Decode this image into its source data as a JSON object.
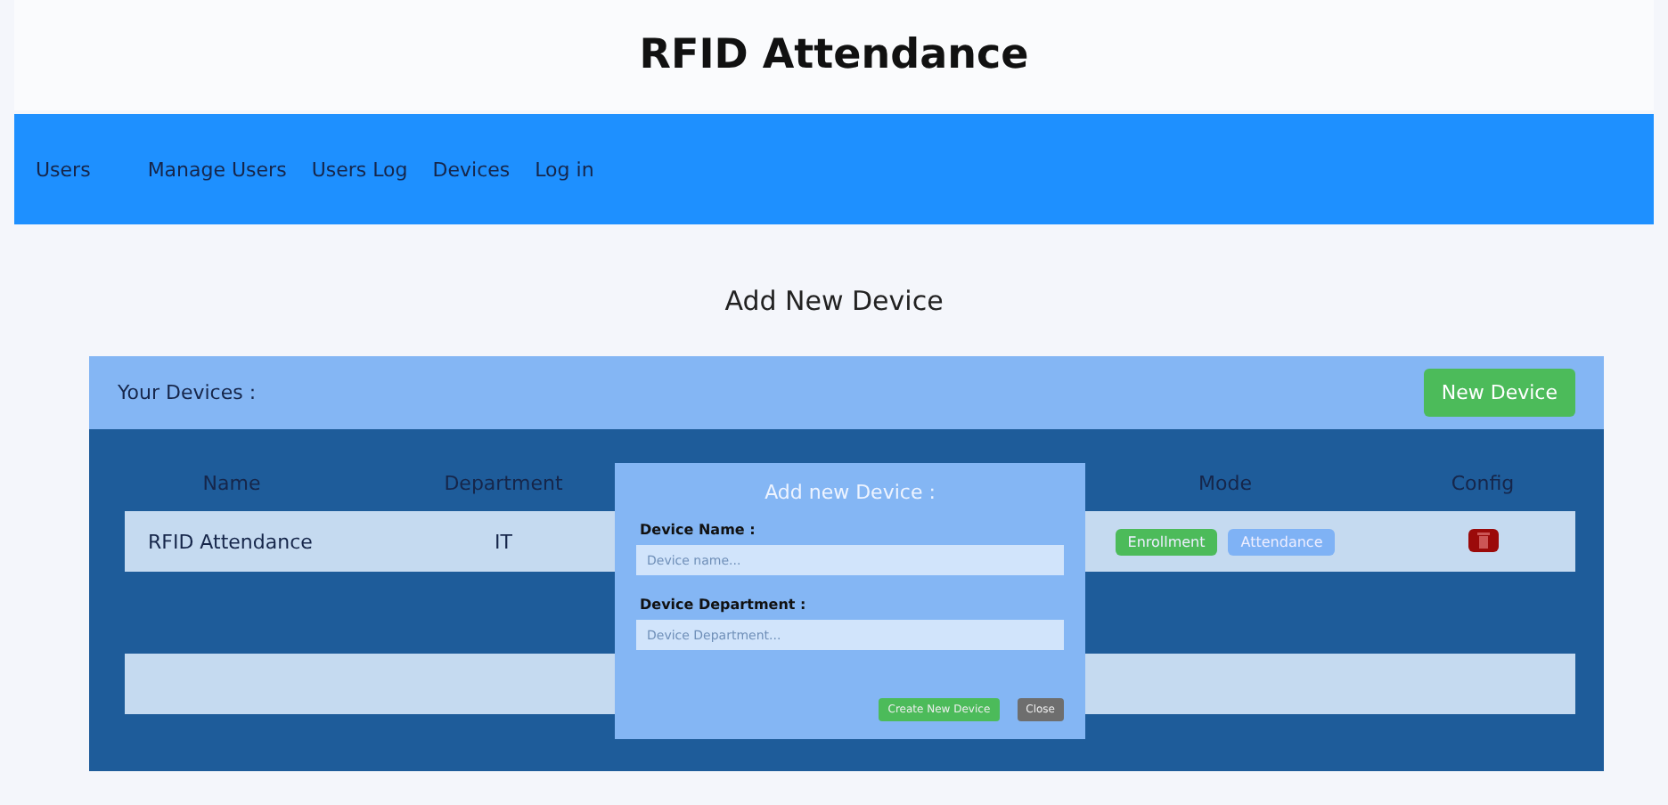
{
  "header": {
    "title": "RFID Attendance"
  },
  "nav": [
    {
      "label": "Users"
    },
    {
      "label": "Manage Users"
    },
    {
      "label": "Users Log"
    },
    {
      "label": "Devices"
    },
    {
      "label": "Log in"
    }
  ],
  "page_title": "Add New Device",
  "panel": {
    "title": "Your Devices :",
    "new_button": "New Device"
  },
  "table": {
    "columns": [
      "Name",
      "Department",
      "Mode",
      "Config"
    ],
    "rows": [
      {
        "name": "RFID Attendance",
        "department": "IT",
        "modes": [
          {
            "label": "Enrollment",
            "selected": true
          },
          {
            "label": "Attendance",
            "selected": false
          }
        ]
      }
    ]
  },
  "dialog": {
    "title": "Add new Device :",
    "fields": [
      {
        "label": "Device Name :",
        "placeholder": "Device name..."
      },
      {
        "label": "Device Department :",
        "placeholder": "Device Department..."
      }
    ],
    "buttons": [
      {
        "label": "Create New Device",
        "kind": "primary"
      },
      {
        "label": "Close",
        "kind": "secondary"
      }
    ]
  }
}
